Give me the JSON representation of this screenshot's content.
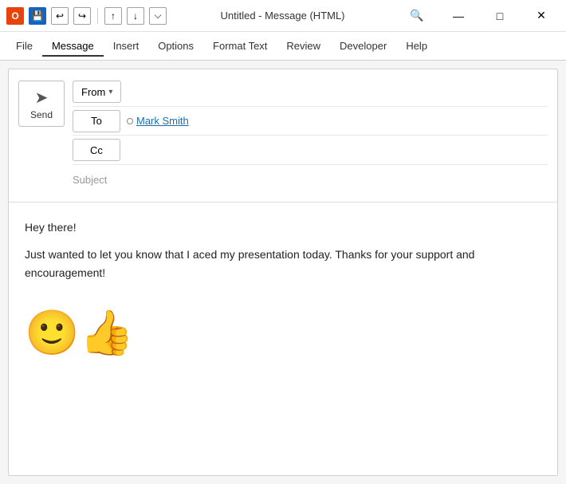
{
  "titleBar": {
    "appIcon": "O",
    "title": "Untitled  -  Message (HTML)",
    "saveIcon": "💾",
    "undoIcon": "↩",
    "redoIcon": "↪",
    "upArrow": "↑",
    "downArrow": "↓",
    "dropArrow": "⌵",
    "searchLabel": "🔍",
    "minimizeLabel": "—",
    "maximizeLabel": "□",
    "closeLabel": "✕"
  },
  "menuBar": {
    "items": [
      {
        "id": "file",
        "label": "File"
      },
      {
        "id": "message",
        "label": "Message",
        "active": true
      },
      {
        "id": "insert",
        "label": "Insert"
      },
      {
        "id": "options",
        "label": "Options"
      },
      {
        "id": "format-text",
        "label": "Format Text"
      },
      {
        "id": "review",
        "label": "Review"
      },
      {
        "id": "developer",
        "label": "Developer"
      },
      {
        "id": "help",
        "label": "Help"
      }
    ]
  },
  "compose": {
    "sendButton": {
      "icon": "➤",
      "label": "Send"
    },
    "fromButton": "From",
    "fromDropdownIcon": "▾",
    "toButton": "To",
    "ccButton": "Cc",
    "toRecipient": {
      "name": "Mark Smith",
      "hasUnderline": true
    },
    "subjectPlaceholder": "Subject"
  },
  "body": {
    "greeting": "Hey there!",
    "paragraph": "Just wanted to let you know that I aced my presentation today. Thanks for your support and encouragement!",
    "emoji": "👍😊"
  }
}
